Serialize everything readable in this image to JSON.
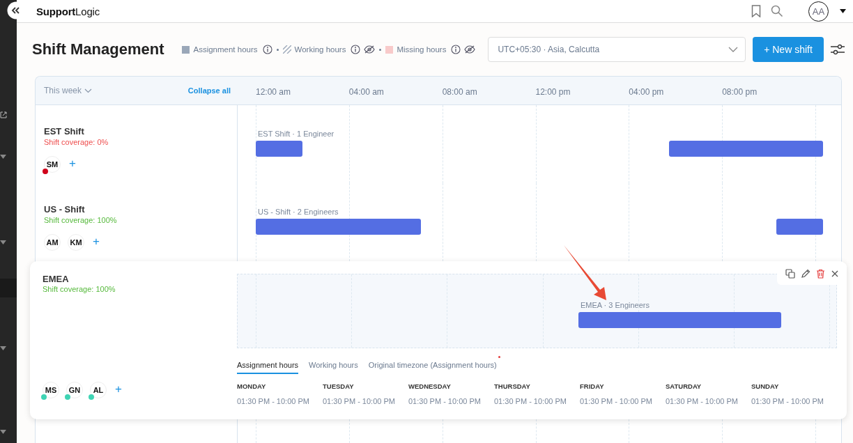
{
  "header": {
    "logo": "**Support**Logic",
    "avatar": "AA"
  },
  "title": "Shift Management",
  "legend": [
    {
      "kind": "solid",
      "label": "Assignment hours",
      "hidden": false
    },
    {
      "kind": "hatched",
      "label": "Working hours",
      "hidden": true
    },
    {
      "kind": "missing",
      "label": "Missing hours",
      "hidden": true
    }
  ],
  "timezone": {
    "value": "UTC+05:30 · Asia, Calcutta"
  },
  "new_shift_button": "+ New shift",
  "table": {
    "range": "This week",
    "collapse": "Collapse all",
    "hours": [
      "12:00 am",
      "04:00 am",
      "08:00 am",
      "12:00 pm",
      "04:00 pm",
      "08:00 pm"
    ]
  },
  "shifts": [
    {
      "name": "EST Shift",
      "coverage": "Shift coverage: 0%",
      "coverage_ok": false,
      "expanded": false,
      "add": "+",
      "members": [
        {
          "initials": "SM",
          "color": "#d0021b"
        }
      ],
      "bars": [
        {
          "kind": "start",
          "label": "EST Shift · 1 Engineer"
        },
        {
          "kind": "end"
        }
      ]
    },
    {
      "name": "US - Shift",
      "coverage": "Shift coverage: 100%",
      "coverage_ok": true,
      "expanded": false,
      "add": "+",
      "members": [
        {
          "initials": "AM"
        },
        {
          "initials": "KM"
        }
      ],
      "bars": [
        {
          "kind": "start",
          "label": "US - Shift · 2 Engineers"
        },
        {
          "kind": "end"
        }
      ]
    },
    {
      "name": "EMEA",
      "coverage": "Shift coverage: 100%",
      "coverage_ok": true,
      "expanded": true,
      "add": "+",
      "members": [
        {
          "initials": "MS",
          "color": "#3fd4b4"
        },
        {
          "initials": "GN",
          "color": "#3fd4b4"
        },
        {
          "initials": "AL",
          "color": "#3fd4b4"
        }
      ],
      "bars": [
        {
          "kind": "schedule",
          "label": "EMEA · 3 Engineers"
        }
      ],
      "tabs": [
        {
          "label": "Assignment hours",
          "selected": true,
          "flagged": false
        },
        {
          "label": "Working hours",
          "selected": false,
          "flagged": false
        },
        {
          "label": "Original timezone (Assignment hours)",
          "selected": false,
          "flagged": true
        }
      ],
      "schedule": [
        {
          "day": "MONDAY",
          "hours": "01:30 PM - 10:00 PM"
        },
        {
          "day": "TUESDAY",
          "hours": "01:30 PM - 10:00 PM"
        },
        {
          "day": "WEDNESDAY",
          "hours": "01:30 PM - 10:00 PM"
        },
        {
          "day": "THURSDAY",
          "hours": "01:30 PM - 10:00 PM"
        },
        {
          "day": "FRIDAY",
          "hours": "01:30 PM - 10:00 PM"
        },
        {
          "day": "SATURDAY",
          "hours": "01:30 PM - 10:00 PM"
        },
        {
          "day": "SUNDAY",
          "hours": "01:30 PM - 10:00 PM"
        }
      ]
    }
  ]
}
